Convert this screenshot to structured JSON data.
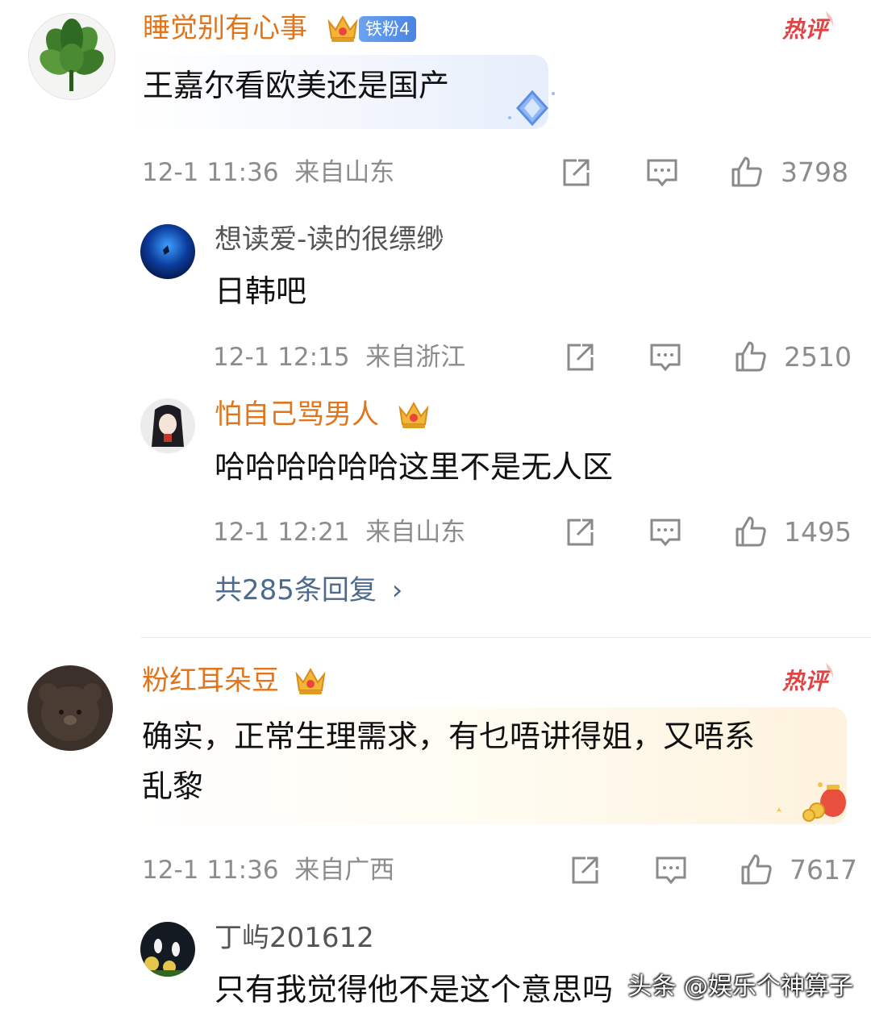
{
  "comments": [
    {
      "username": "睡觉别有心事",
      "fan_badge": "铁粉4",
      "hot_label": "热评",
      "content": "王嘉尔看欧美还是国产",
      "time": "12-1 11:36",
      "location": "来自山东",
      "likes": "3798",
      "replies": [
        {
          "username": "想读爱-读的很缥缈",
          "content": "日韩吧",
          "time": "12-1 12:15",
          "location": "来自浙江",
          "likes": "2510"
        },
        {
          "username": "怕自己骂男人",
          "content": "哈哈哈哈哈哈这里不是无人区",
          "time": "12-1 12:21",
          "location": "来自山东",
          "likes": "1495"
        }
      ],
      "more_replies": "共285条回复"
    },
    {
      "username": "粉红耳朵豆",
      "hot_label": "热评",
      "content_line1": "确实，正常生理需求，有乜唔讲得姐，又唔系",
      "content_line2": "乱黎",
      "time": "12-1 11:36",
      "location": "来自广西",
      "likes": "7617",
      "replies": [
        {
          "username": "丁屿201612",
          "content": "只有我觉得他不是这个意思吗"
        }
      ]
    }
  ],
  "icons": [
    "share-icon",
    "comment-icon",
    "like-icon",
    "crown-icon",
    "hot-comment-badge",
    "chevron-right-icon"
  ],
  "colors": {
    "vip_name": "#e0751c",
    "name": "#555555",
    "meta": "#8c8c8c",
    "link": "#4d6a8c",
    "hot": "#e04545"
  },
  "watermark": "头条 @娱乐个神算子"
}
